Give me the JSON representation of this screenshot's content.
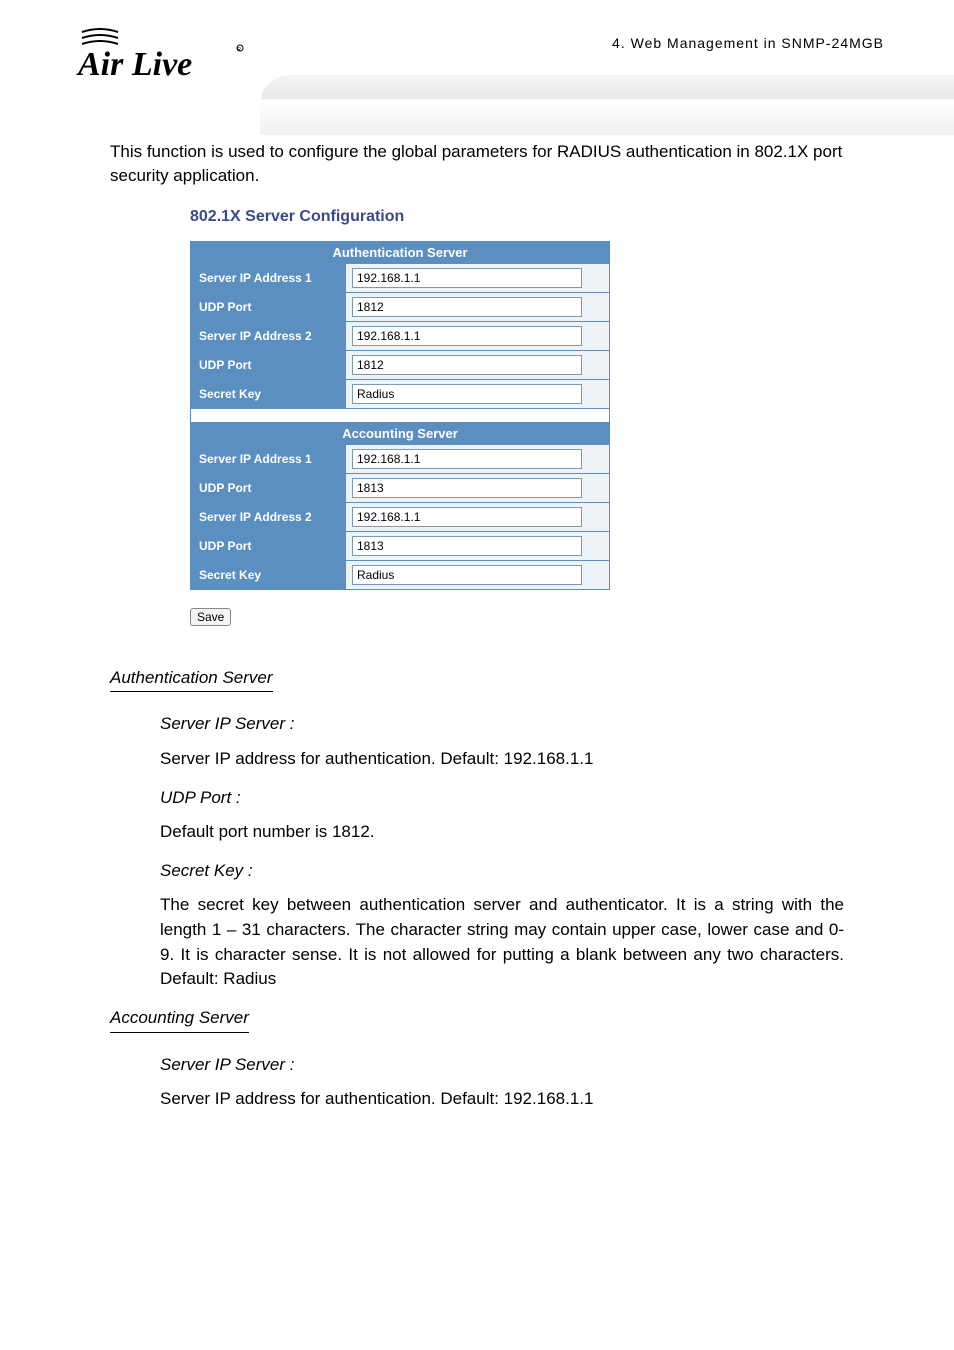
{
  "header": {
    "breadcrumb": "4.  Web Management in SNMP-24MGB",
    "brand_upper": "Air",
    "brand_lower": "Live"
  },
  "intro": "This function is used to configure the global parameters for RADIUS authentication in 802.1X port security application.",
  "config": {
    "title": "802.1X Server Configuration",
    "auth": {
      "group_label": "Authentication Server",
      "rows": {
        "ip1_label": "Server IP Address 1",
        "ip1_value": "192.168.1.1",
        "port1_label": "UDP Port",
        "port1_value": "1812",
        "ip2_label": "Server IP Address 2",
        "ip2_value": "192.168.1.1",
        "port2_label": "UDP Port",
        "port2_value": "1812",
        "key_label": "Secret Key",
        "key_value": "Radius"
      }
    },
    "acct": {
      "group_label": "Accounting Server",
      "rows": {
        "ip1_label": "Server IP Address 1",
        "ip1_value": "192.168.1.1",
        "port1_label": "UDP Port",
        "port1_value": "1813",
        "ip2_label": "Server IP Address 2",
        "ip2_value": "192.168.1.1",
        "port2_label": "UDP Port",
        "port2_value": "1813",
        "key_label": "Secret Key",
        "key_value": "Radius"
      }
    },
    "save_label": "Save"
  },
  "desc": {
    "auth_heading": "Authentication Server",
    "auth_ip_label": "Server IP Server :",
    "auth_ip_text": "Server IP address for authentication. Default: 192.168.1.1",
    "auth_port_label": "UDP Port :",
    "auth_port_text": "Default port number is 1812.",
    "auth_key_label": "Secret Key :",
    "auth_key_text": "The secret key between authentication server and authenticator. It is a string with the length 1 – 31 characters. The character string may contain upper case, lower case and 0-9. It is character sense. It is not allowed for putting a blank between any two characters. Default: Radius",
    "acct_heading": "Accounting Server",
    "acct_ip_label": "Server IP Server :",
    "acct_ip_text": "Server IP address for authentication. Default: 192.168.1.1"
  }
}
